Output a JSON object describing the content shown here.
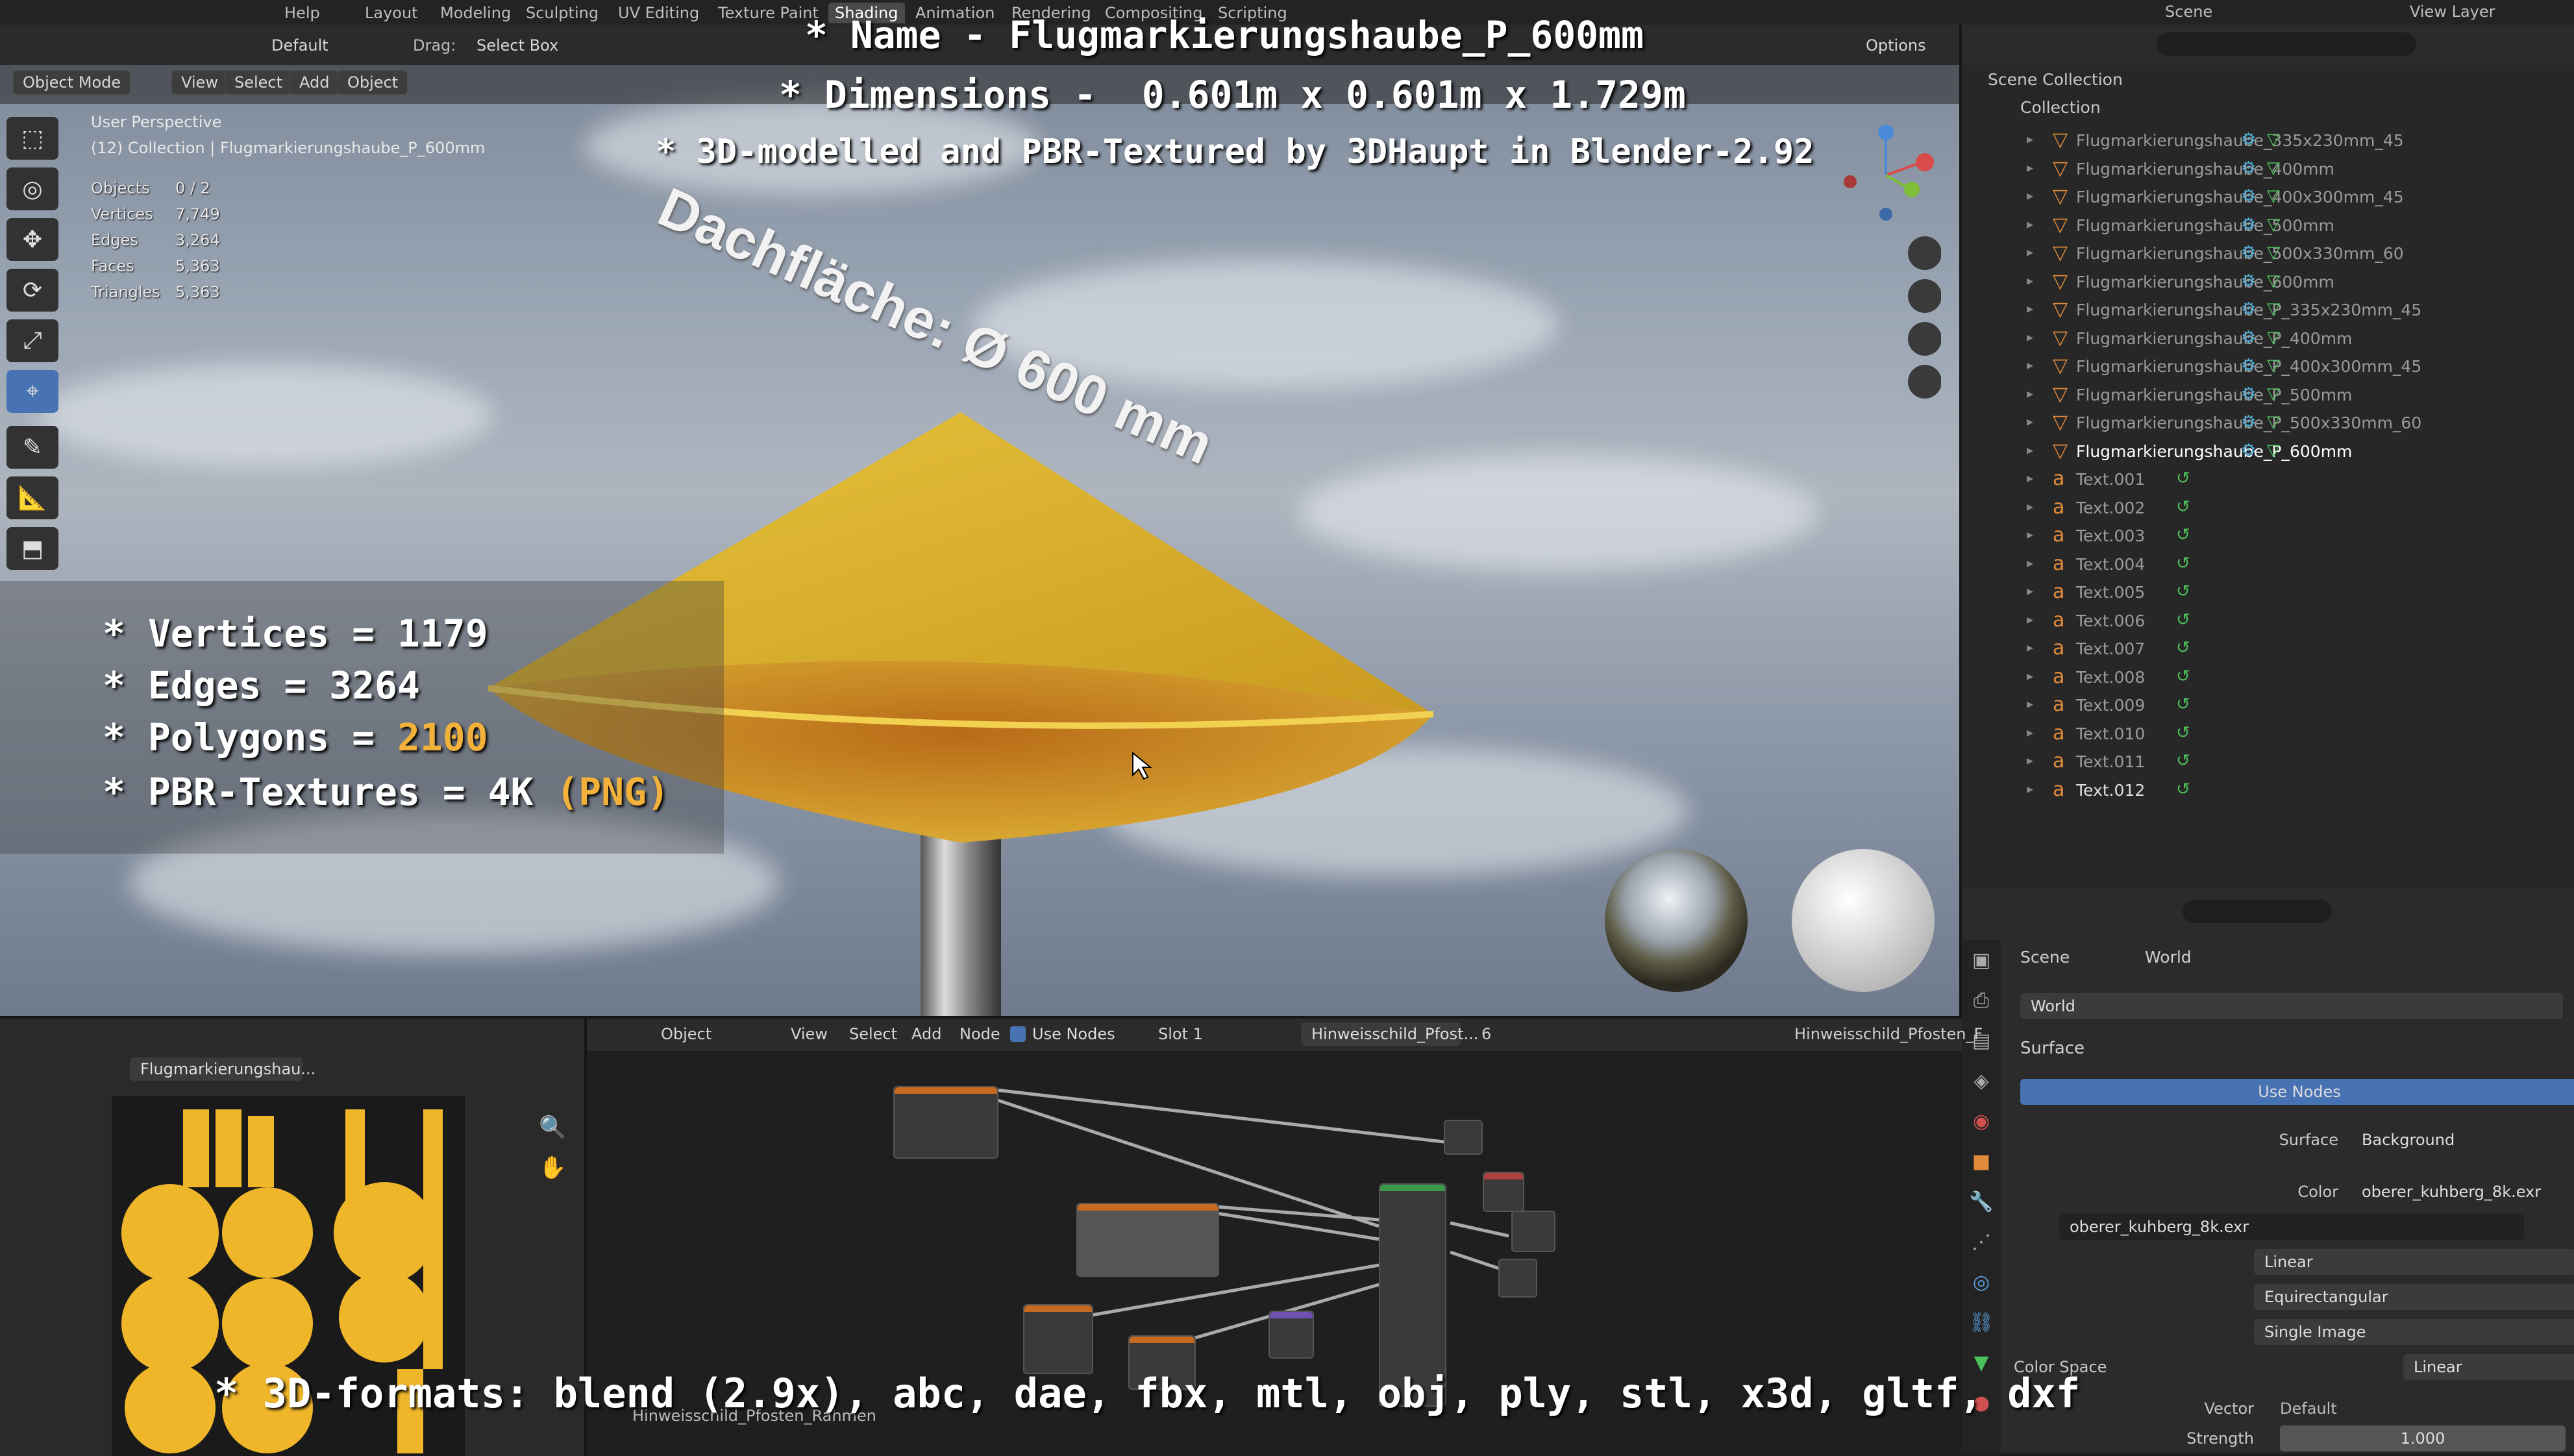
{
  "menu": {
    "help": "Help",
    "workspaces": [
      "Layout",
      "Modeling",
      "Sculpting",
      "UV Editing",
      "Texture Paint",
      "Shading",
      "Animation",
      "Rendering",
      "Compositing",
      "Scripting"
    ],
    "active": "Shading",
    "scene": "Scene",
    "view_layer": "View Layer"
  },
  "viewport_header": {
    "mode": "Object Mode",
    "view": "View",
    "select": "Select",
    "add": "Add",
    "object": "Object",
    "orientation": "Default",
    "drag_label": "Drag:",
    "drag_value": "Select Box",
    "options": "Options"
  },
  "overlay": {
    "name_line": "* Name - Flugmarkierungshaube_P_600mm",
    "dims_line": "* Dimensions -  0.601m x 0.601m x 1.729m",
    "model_line": "* 3D-modelled and PBR-Textured by 3DHaupt in Blender-2.92",
    "vertices": "* Vertices = 1179",
    "edges": "* Edges = 3264",
    "polygons_prefix": "* Polygons = ",
    "polygons_value": "2100",
    "textures_prefix": "* PBR-Textures = 4K ",
    "textures_suffix": "(PNG)",
    "formats": "* 3D-formats: blend (2.9x), abc, dae, fbx, mtl, obj, ply, stl, x3d, gltf, dxf",
    "sign_text": "Dachfläche: Ø 600 mm"
  },
  "viewport_info": {
    "perspective": "User Perspective",
    "collection": "(12) Collection | Flugmarkierungshaube_P_600mm",
    "stats": [
      {
        "k": "Objects",
        "v": "0 / 2"
      },
      {
        "k": "Vertices",
        "v": "7,749"
      },
      {
        "k": "Edges",
        "v": "3,264"
      },
      {
        "k": "Faces",
        "v": "5,363"
      },
      {
        "k": "Triangles",
        "v": "5,363"
      }
    ]
  },
  "outliner": {
    "scene_collection": "Scene Collection",
    "collection": "Collection",
    "items": [
      "Flugmarkierungshaube_335x230mm_45",
      "Flugmarkierungshaube_400mm",
      "Flugmarkierungshaube_400x300mm_45",
      "Flugmarkierungshaube_500mm",
      "Flugmarkierungshaube_500x330mm_60",
      "Flugmarkierungshaube_600mm",
      "Flugmarkierungshaube_P_335x230mm_45",
      "Flugmarkierungshaube_P_400mm",
      "Flugmarkierungshaube_P_400x300mm_45",
      "Flugmarkierungshaube_P_500mm",
      "Flugmarkierungshaube_P_500x330mm_60",
      "Flugmarkierungshaube_P_600mm",
      "Text.001",
      "Text.002",
      "Text.003",
      "Text.004",
      "Text.005",
      "Text.006",
      "Text.007",
      "Text.008",
      "Text.009",
      "Text.010",
      "Text.011",
      "Text.012"
    ]
  },
  "properties": {
    "tab_scene": "Scene",
    "tab_world": "World",
    "world_name": "World",
    "surface_section": "Surface",
    "use_nodes": "Use Nodes",
    "surface_label": "Surface",
    "surface_value": "Background",
    "color_label": "Color",
    "color_value": "oberer_kuhberg_8k.exr",
    "image_name": "oberer_kuhberg_8k.exr",
    "interp": "Linear",
    "projection": "Equirectangular",
    "source": "Single Image",
    "color_space_label": "Color Space",
    "color_space_value": "Linear",
    "vector_label": "Vector",
    "vector_value": "Default",
    "strength_label": "Strength",
    "strength_value": "1.000"
  },
  "image_editor": {
    "image_name": "Flugmarkierungshau..."
  },
  "node_editor": {
    "object": "Object",
    "view": "View",
    "select": "Select",
    "add": "Add",
    "node": "Node",
    "use_nodes": "Use Nodes",
    "slot": "Slot 1",
    "material": "Hinweisschild_Pfost...",
    "users": "6",
    "material_full": "Hinweisschild_Pfosten_F",
    "node_label": "Hinweisschild_Pfosten_Rahmen"
  }
}
